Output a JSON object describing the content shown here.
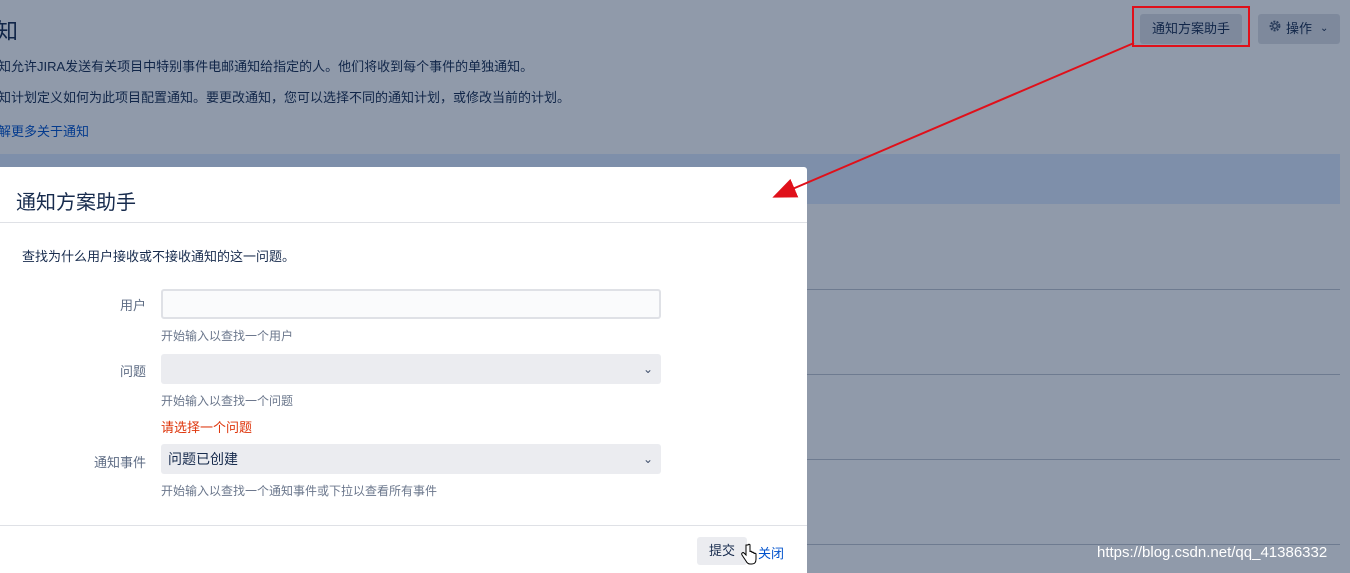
{
  "page": {
    "title": "知",
    "desc1": "知允许JIRA发送有关项目中特别事件电邮通知给指定的人。他们将收到每个事件的单独通知。",
    "desc2": "知计划定义如何为此项目配置通知。要更改通知，您可以选择不同的通知计划，或修改当前的计划。",
    "learn_more": "解更多关于通知",
    "helper_button": "通知方案助手",
    "actions_button": "操作"
  },
  "dialog": {
    "title": "通知方案助手",
    "intro": "查找为什么用户接收或不接收通知的这一问题。",
    "user_label": "用户",
    "user_value": "",
    "user_hint": "开始输入以查找一个用户",
    "issue_label": "问题",
    "issue_value": "",
    "issue_hint": "开始输入以查找一个问题",
    "issue_error": "请选择一个问题",
    "event_label": "通知事件",
    "event_value": "问题已创建",
    "event_hint": "开始输入以查找一个通知事件或下拉以查看所有事件",
    "submit": "提交",
    "close": "关闭"
  },
  "watermark": "https://blog.csdn.net/qq_41386332",
  "colors": {
    "annotation_red": "#e0101a",
    "link": "#0052cc",
    "error": "#de350b"
  }
}
